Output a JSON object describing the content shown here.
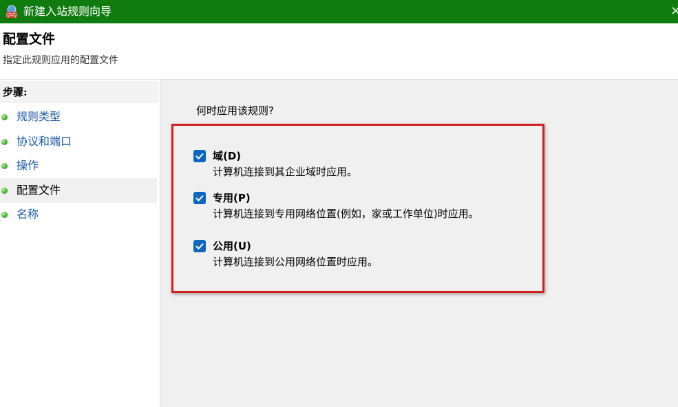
{
  "window": {
    "title": "新建入站规则向导",
    "close_glyph": "×",
    "accent_color": "#107c10"
  },
  "header": {
    "title": "配置文件",
    "subtitle": "指定此规则应用的配置文件"
  },
  "steps": {
    "heading": "步骤:",
    "items": [
      {
        "label": "规则类型",
        "active": false
      },
      {
        "label": "协议和端口",
        "active": false
      },
      {
        "label": "操作",
        "active": false
      },
      {
        "label": "配置文件",
        "active": true
      },
      {
        "label": "名称",
        "active": false
      }
    ]
  },
  "main": {
    "question": "何时应用该规则?",
    "highlight_color": "#d22020",
    "options": [
      {
        "label": "域(D)",
        "description": "计算机连接到其企业域时应用。",
        "checked": true
      },
      {
        "label": "专用(P)",
        "description": "计算机连接到专用网络位置(例如，家或工作单位)时应用。",
        "checked": true
      },
      {
        "label": "公用(U)",
        "description": "计算机连接到公用网络位置时应用。",
        "checked": true
      }
    ]
  }
}
